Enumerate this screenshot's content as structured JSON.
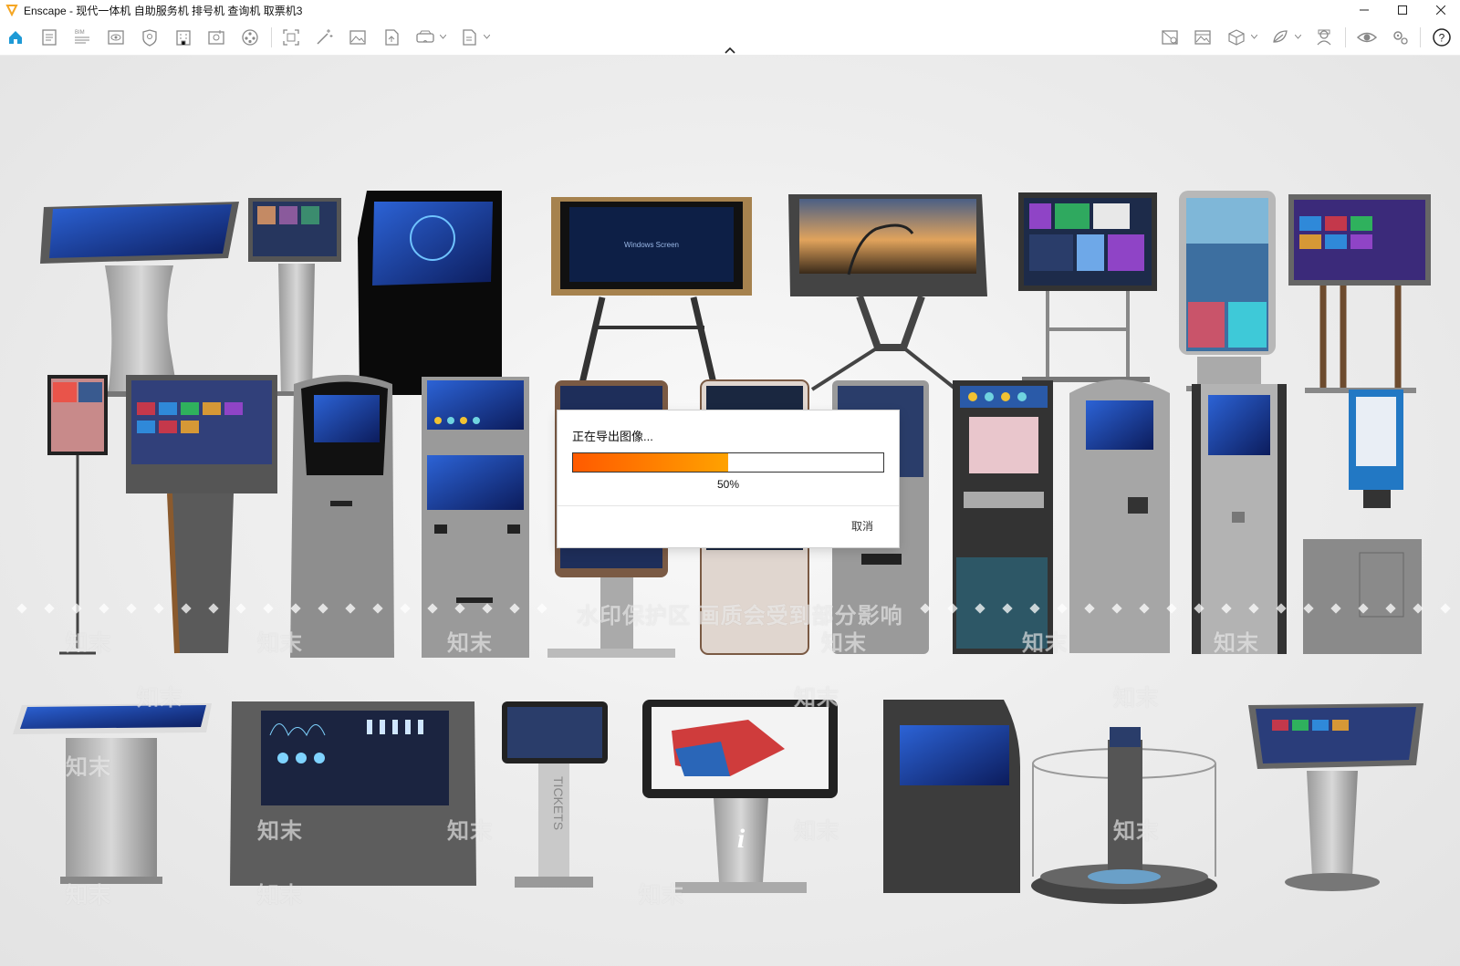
{
  "window": {
    "title": "Enscape - 现代一体机 自助服务机 排号机 查询机 取票机3",
    "brand_color": "#f5a623"
  },
  "toolbar": {
    "left_icons": [
      "home-icon",
      "document-icon",
      "bim-list-icon",
      "visibility-icon",
      "material-icon",
      "building-icon",
      "asset-library-icon",
      "reel-icon",
      "capture-icon",
      "magic-wand-icon",
      "image-icon",
      "export-file-icon",
      "vr-headset-icon",
      "batch-export-icon"
    ],
    "right_icons": [
      "render-settings-icon",
      "panorama-icon",
      "cube-icon",
      "atmosphere-icon",
      "avatar-icon",
      "eye-icon",
      "settings-icon",
      "help-icon"
    ],
    "accent_color": "#1e9ad6"
  },
  "viewport": {
    "watermark_main": "水印保护区  画质会受到部分影响",
    "watermark_brand": "知末"
  },
  "dialog": {
    "message": "正在导出图像...",
    "progress": 0.5,
    "progress_text": "50%",
    "cancel_label": "取消"
  }
}
